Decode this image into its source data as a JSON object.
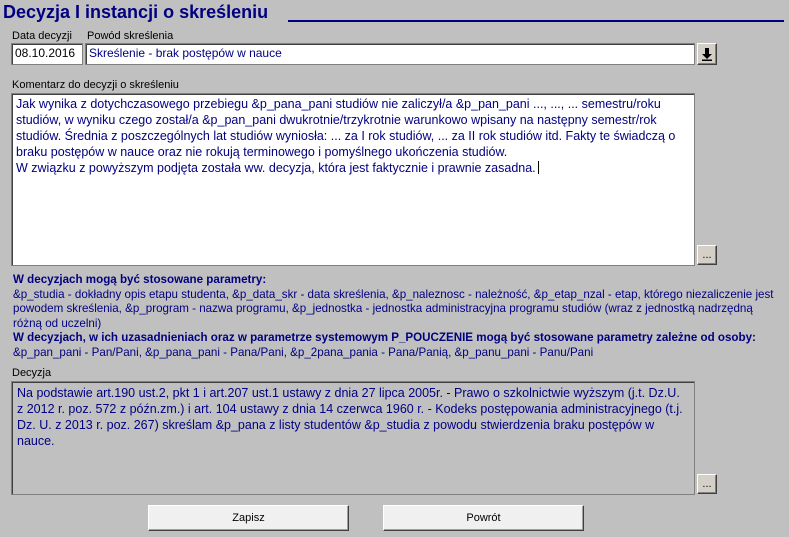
{
  "window": {
    "title": "Decyzja I instancji o skreśleniu"
  },
  "form": {
    "date_label": "Data decyzji",
    "date_value": "08.10.2016",
    "reason_label": "Powód skreślenia",
    "reason_value": "Skreślenie - brak postępów w nauce",
    "comment_label": "Komentarz do decyzji o skreśleniu",
    "comment_paragraphs": [
      "Jak wynika z dotychczasowego przebiegu &p_pana_pani studiów nie zaliczył/a &p_pan_pani ..., ..., ... semestru/roku studiów, w wyniku czego został/a &p_pan_pani dwukrotnie/trzykrotnie warunkowo wpisany na następny semestr/rok studiów. Średnia z poszczególnych lat studiów wyniosła: ... za I rok studiów, ... za II rok studiów itd. Fakty te świadczą o braku postępów w nauce oraz nie rokują terminowego i pomyślnego ukończenia studiów.",
      "W związku z powyższym podjęta została ww. decyzja, która jest faktycznie i prawnie zasadna."
    ],
    "ellipsis_label": "...",
    "decision_label": "Decyzja",
    "decision_text": "Na podstawie art.190 ust.2, pkt 1 i art.207 ust.1 ustawy z dnia 27 lipca 2005r. - Prawo o szkolnictwie wyższym (j.t. Dz.U. z 2012 r. poz. 572 z późn.zm.) i art. 104 ustawy z dnia 14 czerwca 1960 r. - Kodeks postępowania administracyjnego (t.j. Dz. U. z 2013 r. poz. 267)  skreślam &p_pana z listy studentów &p_studia z powodu stwierdzenia braku postępów w nauce."
  },
  "params": {
    "heading1": "W decyzjach mogą być stosowane parametry:",
    "text1": "&p_studia - dokładny opis etapu studenta, &p_data_skr - data skreślenia, &p_naleznosc - należność, &p_etap_nzal - etap, którego niezaliczenie jest powodem skreślenia, &p_program - nazwa programu, &p_jednostka - jednostka administracyjna programu studiów (wraz z jednostką nadrzędną różną od uczelni)",
    "heading2": "W decyzjach, w ich uzasadnieniach oraz w parametrze systemowym P_POUCZENIE mogą być stosowane parametry zależne od osoby:",
    "text2": "&p_pan_pani - Pan/Pani, &p_pana_pani - Pana/Pani, &p_2pana_pania - Pana/Panią, &p_panu_pani - Panu/Pani"
  },
  "buttons": {
    "save": "Zapisz",
    "back": "Powrót"
  },
  "icons": {
    "dropdown": "download-arrow-icon"
  },
  "colors": {
    "background": "#c0c0c0",
    "accent": "#000080"
  }
}
